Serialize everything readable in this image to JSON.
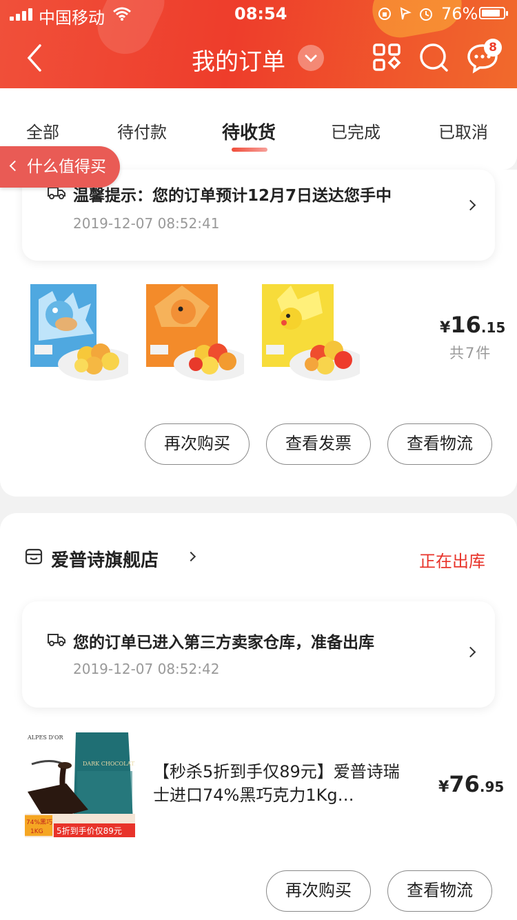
{
  "status_bar": {
    "carrier": "中国移动",
    "time": "08:54",
    "battery": "76%"
  },
  "header": {
    "title": "我的订单",
    "message_badge": "8"
  },
  "tabs": [
    {
      "label": "全部"
    },
    {
      "label": "待付款"
    },
    {
      "label": "待收货"
    },
    {
      "label": "已完成"
    },
    {
      "label": "已取消"
    }
  ],
  "active_tab": "待收货",
  "float_tag": {
    "label": "什么值得买"
  },
  "order1": {
    "notice": "温馨提示：您的订单预计12月7日送达您手中",
    "notice_time": "2019-12-07 08:52:41",
    "price_symbol": "¥",
    "price_int": "16",
    "price_dec": ".15",
    "count": "共7件",
    "buttons": [
      "再次购买",
      "查看发票",
      "查看物流"
    ]
  },
  "order2": {
    "shop_name": "爱普诗旗舰店",
    "status": "正在出库",
    "notice": "您的订单已进入第三方卖家仓库，准备出库",
    "notice_time": "2019-12-07 08:52:42",
    "product_title": "【秒杀5折到手仅89元】爱普诗瑞士进口74%黑巧克力1Kg…",
    "image_text": {
      "brand": "ALPES D'OR",
      "pack": "DARK CHOCOLATE",
      "tag1": "74%黑巧",
      "tag2": "1KG",
      "promo": "5折到手价仅89元"
    },
    "price_symbol": "¥",
    "price_int": "76",
    "price_dec": ".95",
    "buttons": [
      "再次购买",
      "查看物流"
    ]
  },
  "colors": {
    "brand_red": "#ee3d2b",
    "status_red": "#e8332a",
    "float_tag": "#e95b55"
  }
}
